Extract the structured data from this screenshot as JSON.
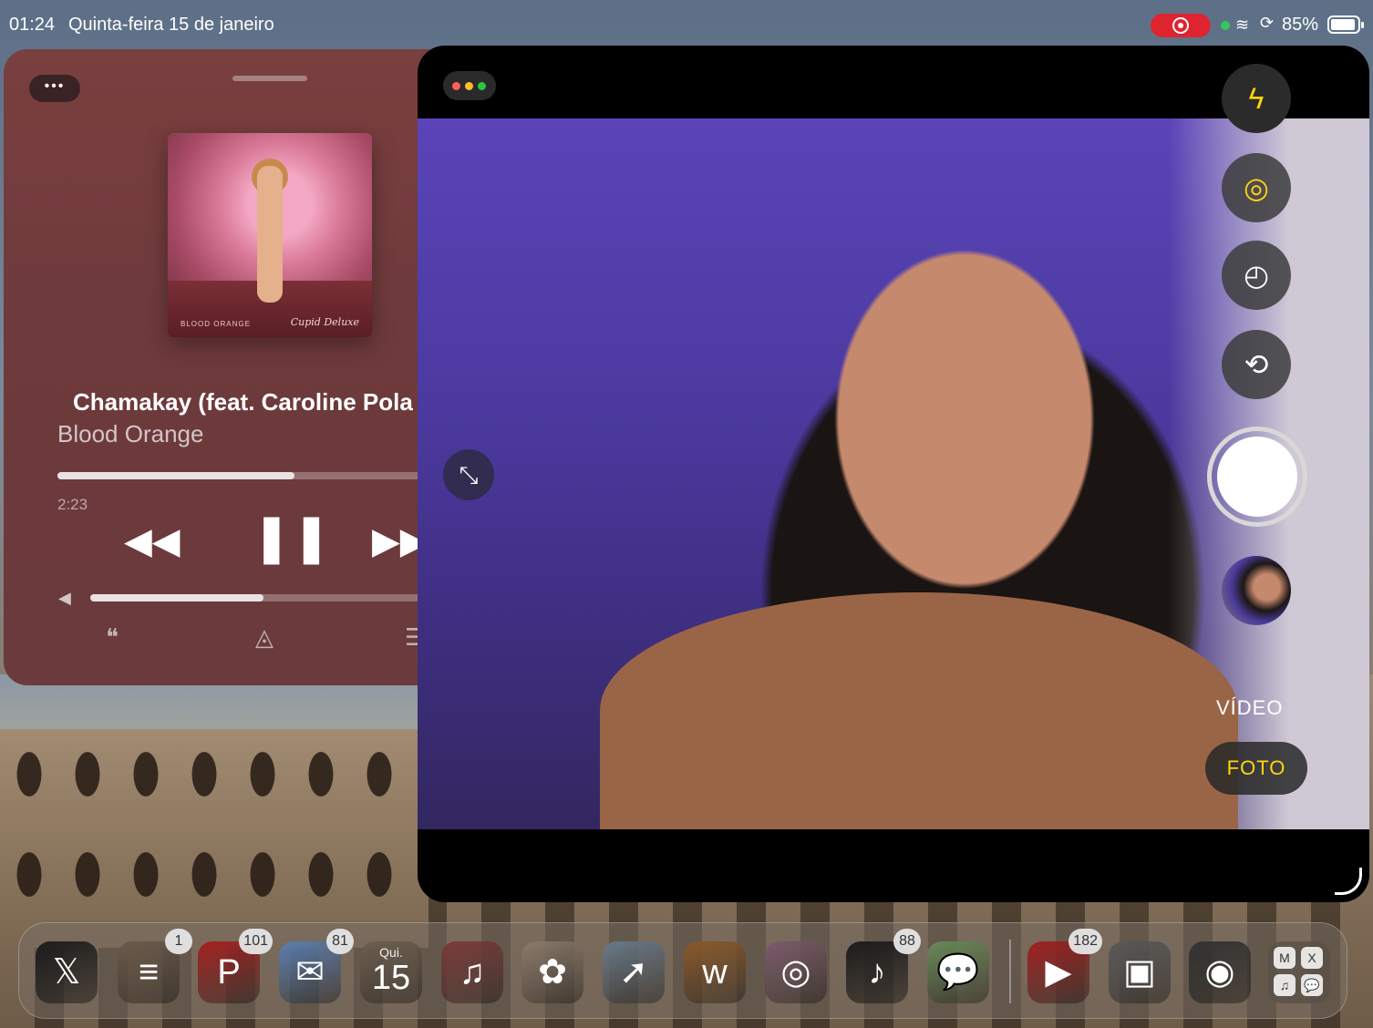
{
  "status_bar": {
    "time": "01:24",
    "date": "Quinta-feira 15 de janeiro",
    "battery_percent": "85%",
    "battery_level": 0.85,
    "recording_color": "#e0242f"
  },
  "music": {
    "song_title": "Chamakay (feat. Caroline Pola",
    "artist": "Blood Orange",
    "album_label_left": "BLOOD ORANGE",
    "album_label_right": "Cupid Deluxe",
    "elapsed": "2:23",
    "progress_fraction": 0.62,
    "volume_fraction": 0.5,
    "icons": {
      "rewind": "rewind-icon",
      "pause": "pause-icon",
      "forward": "fast-forward-icon",
      "volume": "speaker-icon",
      "lyrics": "lyrics-icon",
      "airplay": "airplay-icon",
      "queue": "queue-icon"
    }
  },
  "camera": {
    "video_label": "VÍDEO",
    "photo_label": "FOTO",
    "accent_color": "#ffd60a",
    "icons": {
      "flash": "flash-auto-icon",
      "live": "live-photo-icon",
      "timer": "timer-icon",
      "flip": "flip-camera-icon",
      "expand": "expand-icon"
    }
  },
  "dock": {
    "apps": [
      {
        "name": "X",
        "glyph": "𝕏",
        "badge": ""
      },
      {
        "name": "Reading List",
        "glyph": "≡",
        "badge": "1"
      },
      {
        "name": "Pinterest",
        "glyph": "P",
        "badge": "101"
      },
      {
        "name": "Mail",
        "glyph": "✉",
        "badge": "81"
      },
      {
        "name": "Calendar",
        "glyph": "",
        "badge": "",
        "day": "Qui.",
        "date": "15"
      },
      {
        "name": "Music",
        "glyph": "♫",
        "badge": ""
      },
      {
        "name": "Photos",
        "glyph": "✿",
        "badge": ""
      },
      {
        "name": "Safari",
        "glyph": "➚",
        "badge": ""
      },
      {
        "name": "Wattpad",
        "glyph": "w",
        "badge": ""
      },
      {
        "name": "Instagram",
        "glyph": "◎",
        "badge": ""
      },
      {
        "name": "TikTok",
        "glyph": "♪",
        "badge": "88"
      },
      {
        "name": "Messages",
        "glyph": "💬",
        "badge": ""
      },
      {
        "name": "YouTube",
        "glyph": "▶",
        "badge": "182"
      },
      {
        "name": "Wallet",
        "glyph": "▣",
        "badge": ""
      },
      {
        "name": "Camera",
        "glyph": "◉",
        "badge": ""
      }
    ],
    "folder_items": [
      "M",
      "X",
      "♫",
      "💬"
    ]
  }
}
